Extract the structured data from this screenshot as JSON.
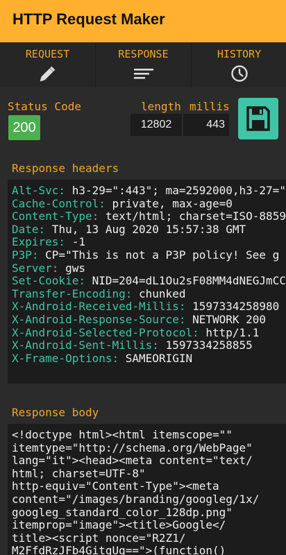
{
  "app": {
    "title": "HTTP Request Maker"
  },
  "tabs": [
    {
      "label": "REQUEST",
      "icon": "pencil-icon"
    },
    {
      "label": "RESPONSE",
      "icon": "lines-icon"
    },
    {
      "label": "HISTORY",
      "icon": "clock-icon"
    }
  ],
  "status": {
    "label": "Status Code",
    "code": "200",
    "color": "#4caf50"
  },
  "metrics": {
    "length_label": "length",
    "millis_label": "millis",
    "length": "12802",
    "millis": "443"
  },
  "save_button": {
    "icon": "floppy-disk-icon",
    "color": "#3fc5a5"
  },
  "headers_section": {
    "title": "Response headers",
    "rows": [
      {
        "key": "Alt-Svc:",
        "value": " h3-29=\":443\"; ma=2592000,h3-27=\""
      },
      {
        "key": "Cache-Control:",
        "value": " private, max-age=0"
      },
      {
        "key": "Content-Type:",
        "value": " text/html; charset=ISO-8859"
      },
      {
        "key": "Date:",
        "value": " Thu, 13 Aug 2020 15:57:38 GMT"
      },
      {
        "key": "Expires:",
        "value": " -1"
      },
      {
        "key": "P3P:",
        "value": " CP=\"This is not a P3P policy! See g"
      },
      {
        "key": "Server:",
        "value": " gws"
      },
      {
        "key": "Set-Cookie:",
        "value": " NID=204=dL1Ou2sF08MM4dNEGJmCC"
      },
      {
        "key": "Transfer-Encoding:",
        "value": " chunked"
      },
      {
        "key": "X-Android-Received-Millis:",
        "value": " 1597334258980"
      },
      {
        "key": "X-Android-Response-Source:",
        "value": " NETWORK 200"
      },
      {
        "key": "X-Android-Selected-Protocol:",
        "value": " http/1.1"
      },
      {
        "key": "X-Android-Sent-Millis:",
        "value": " 1597334258855"
      },
      {
        "key": "X-Frame-Options:",
        "value": " SAMEORIGIN"
      }
    ]
  },
  "body_section": {
    "title": "Response body",
    "lines": [
      "<!doctype html><html itemscope=\"\"",
      "itemtype=\"http://schema.org/WebPage\"",
      "lang=\"it\"><head><meta content=\"text/",
      "html; charset=UTF-8\"",
      "http-equiv=\"Content-Type\"><meta",
      "content=\"/images/branding/googleg/1x/",
      "googleg_standard_color_128dp.png\"",
      "itemprop=\"image\"><title>Google</",
      "title><script nonce=\"R2Z1/",
      "M2FfdRzJFb4GitgUg==\">(function()"
    ]
  }
}
